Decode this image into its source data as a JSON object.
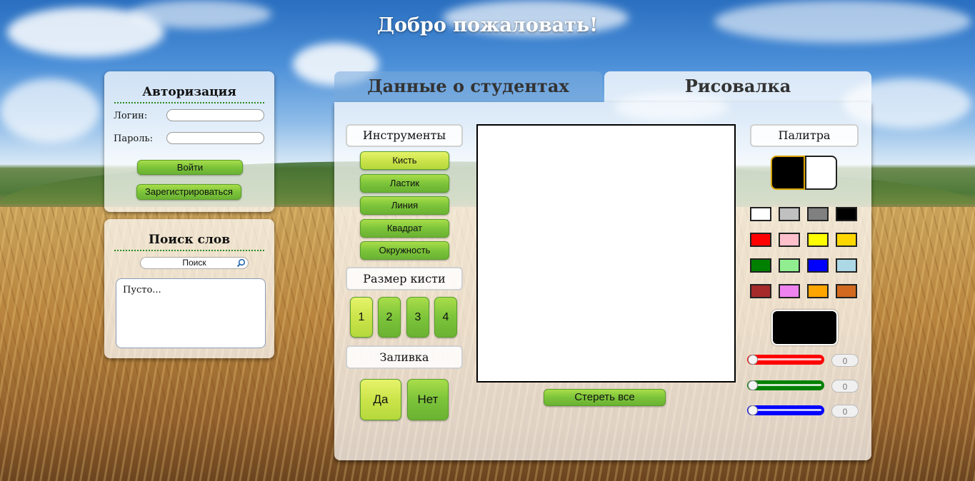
{
  "page": {
    "title": "Добро пожаловать!"
  },
  "auth": {
    "title": "Авторизация",
    "login_label": "Логин:",
    "password_label": "Пароль:",
    "login_value": "",
    "password_value": "",
    "login_button": "Войти",
    "register_button": "Зарегистрироваться"
  },
  "search": {
    "title": "Поиск слов",
    "placeholder": "Поиск",
    "results_text": "Пусто..."
  },
  "tabs": [
    {
      "label": "Данные о студентах",
      "active": false
    },
    {
      "label": "Рисовалка",
      "active": true
    }
  ],
  "tools": {
    "title": "Инструменты",
    "items": [
      "Кисть",
      "Ластик",
      "Линия",
      "Квадрат",
      "Окружность"
    ],
    "selected": "Кисть"
  },
  "brush_size": {
    "title": "Размер кисти",
    "options": [
      "1",
      "2",
      "3",
      "4"
    ],
    "selected": "1"
  },
  "fill": {
    "title": "Заливка",
    "yes": "Да",
    "no": "Нет",
    "selected": "Да"
  },
  "canvas": {
    "clear_button": "Стереть все"
  },
  "palette": {
    "title": "Палитра",
    "primary_color": "#000000",
    "secondary_color": "#ffffff",
    "swatches": [
      "#ffffff",
      "#c0c0c0",
      "#808080",
      "#000000",
      "#ff0000",
      "#ffc0cb",
      "#ffff00",
      "#ffd700",
      "#008000",
      "#90ee90",
      "#0000ff",
      "#add8e6",
      "#a52a2a",
      "#ee82ee",
      "#ffa500",
      "#d2691e"
    ],
    "preview_color": "#000000",
    "rgb": {
      "r": "0",
      "g": "0",
      "b": "0"
    }
  }
}
